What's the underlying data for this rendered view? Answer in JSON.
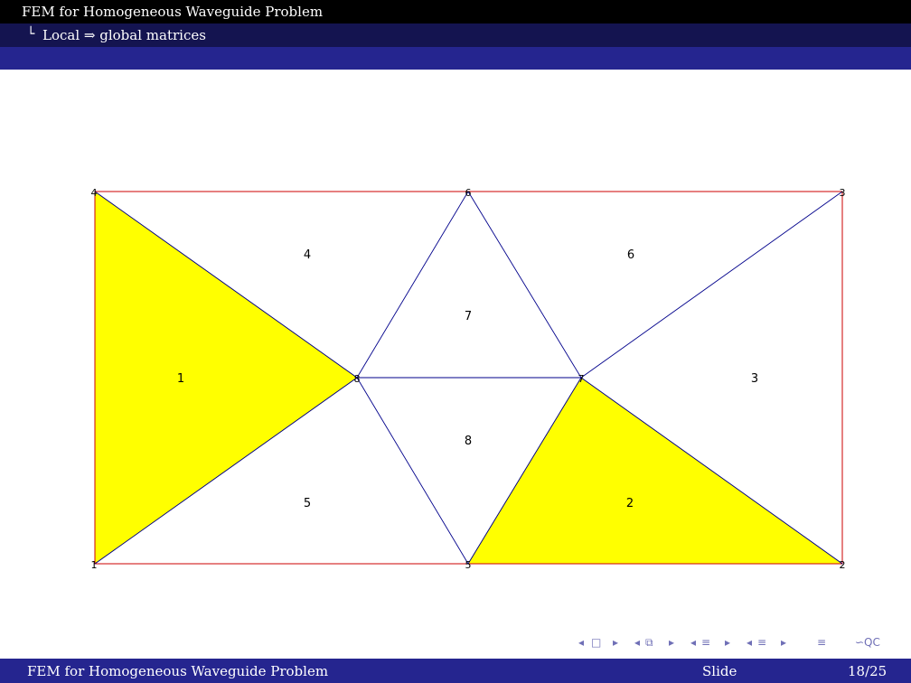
{
  "header": {
    "title": "FEM for Homogeneous Waveguide Problem",
    "subsection_tree": "└",
    "subsection": "Local ⇒ global matrices"
  },
  "mesh": {
    "element_labels": [
      "1",
      "2",
      "3",
      "4",
      "5",
      "6",
      "7",
      "8"
    ],
    "node_labels": [
      "1",
      "2",
      "3",
      "4",
      "5",
      "6",
      "7",
      "8"
    ],
    "highlighted_elements": [
      "1",
      "2"
    ],
    "colors": {
      "highlight_fill": "#ffff00",
      "boundary_edge": "#cc0000",
      "interior_edge": "#00008b"
    }
  },
  "navigation": {
    "icons": [
      "left-arrow-icon",
      "frame-icon",
      "right-arrow-icon",
      "left-arrow-icon",
      "subsection-icon",
      "right-arrow-icon",
      "left-arrow-icon",
      "section-icon",
      "right-arrow-icon",
      "left-arrow-icon",
      "section-icon",
      "right-arrow-icon",
      "align-icon",
      "search-icon"
    ],
    "glyphs": {
      "prev": "◂",
      "next": "▸",
      "frame": "□",
      "subsection": "⧉",
      "section": "≡",
      "align": "≡",
      "search": "∽QC"
    }
  },
  "footer": {
    "title": "FEM for Homogeneous Waveguide Problem",
    "middle": "Slide",
    "page": "18/25"
  }
}
